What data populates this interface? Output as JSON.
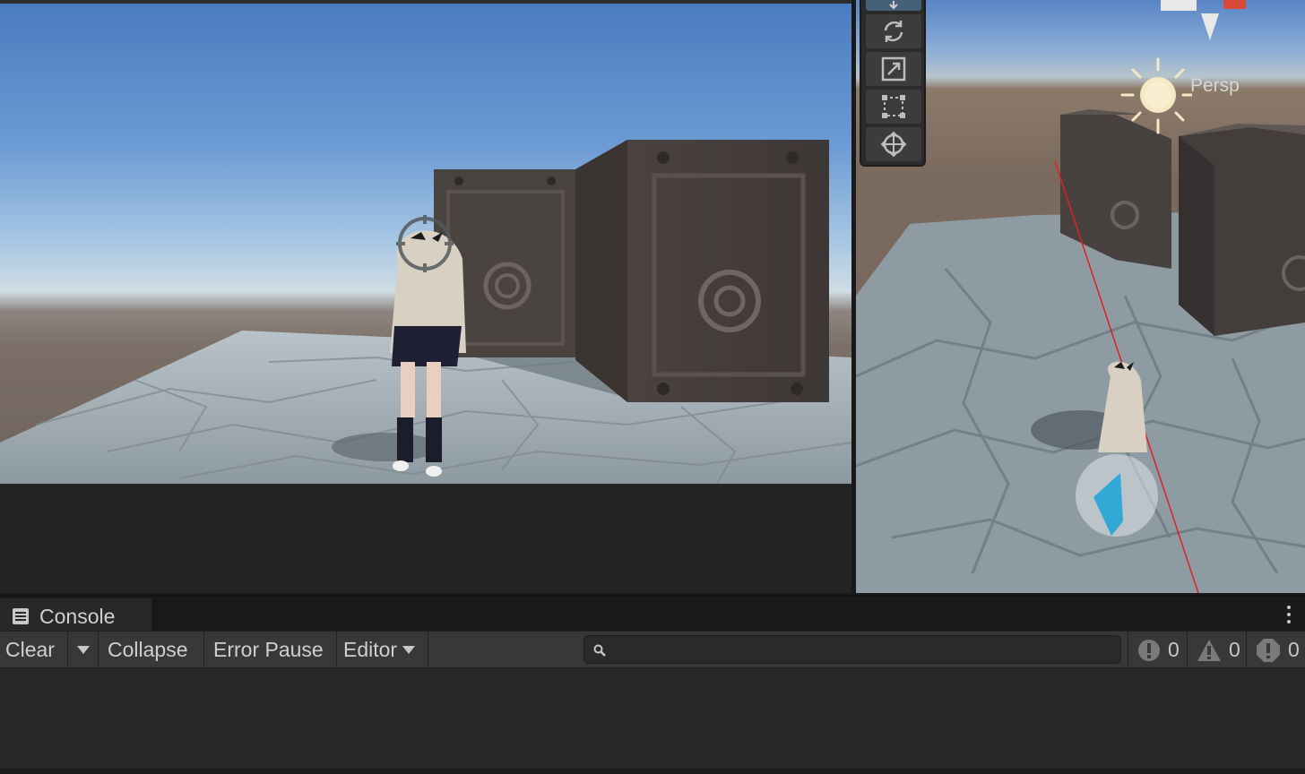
{
  "scene_view": {
    "camera_mode_label": "Persp",
    "tools": [
      {
        "name": "move-tool",
        "icon": "move-arrow-icon"
      },
      {
        "name": "rotate-tool",
        "icon": "rotate-icon"
      },
      {
        "name": "scale-tool",
        "icon": "scale-icon"
      },
      {
        "name": "rect-tool",
        "icon": "rect-transform-icon"
      },
      {
        "name": "transform-tool",
        "icon": "transform-icon"
      }
    ]
  },
  "console": {
    "tab_label": "Console",
    "toolbar": {
      "clear_label": "Clear",
      "collapse_label": "Collapse",
      "error_pause_label": "Error Pause",
      "editor_label": "Editor"
    },
    "search": {
      "placeholder": "",
      "value": ""
    },
    "counts": {
      "info": "0",
      "warnings": "0",
      "errors": "0"
    }
  },
  "colors": {
    "panel_bg": "#282828",
    "toolbar_bg": "#383838",
    "text": "#cfcfcf",
    "gizmo_red": "#e02020"
  }
}
